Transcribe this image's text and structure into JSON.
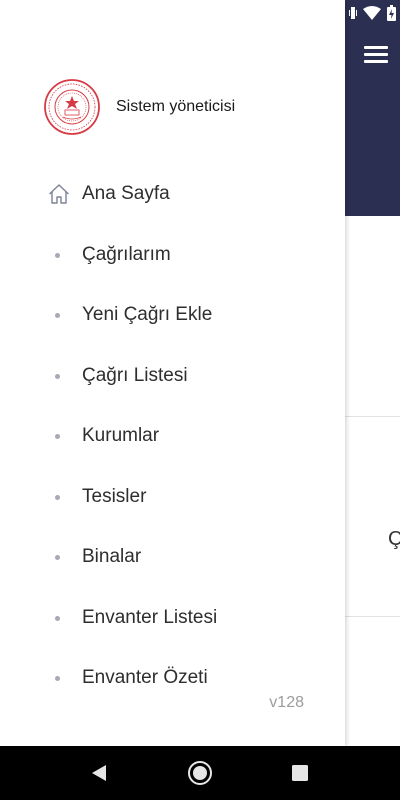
{
  "status_bar": {
    "icons": [
      "vibrate-icon",
      "wifi-icon",
      "battery-charging-icon"
    ]
  },
  "background_app": {
    "header_color": "#2b3052",
    "peek_text": "Ç"
  },
  "drawer": {
    "user_name": "Sistem yöneticisi",
    "menu": [
      {
        "label": "Ana Sayfa",
        "icon": "home-icon"
      },
      {
        "label": "Çağrılarım",
        "icon": "bullet"
      },
      {
        "label": "Yeni Çağrı Ekle",
        "icon": "bullet"
      },
      {
        "label": "Çağrı Listesi",
        "icon": "bullet"
      },
      {
        "label": "Kurumlar",
        "icon": "bullet"
      },
      {
        "label": "Tesisler",
        "icon": "bullet"
      },
      {
        "label": "Binalar",
        "icon": "bullet"
      },
      {
        "label": "Envanter Listesi",
        "icon": "bullet"
      },
      {
        "label": "Envanter Özeti",
        "icon": "bullet"
      }
    ],
    "version": "v128"
  },
  "nav_bar": {
    "buttons": [
      "back-icon",
      "home-circle-icon",
      "recents-icon"
    ]
  }
}
